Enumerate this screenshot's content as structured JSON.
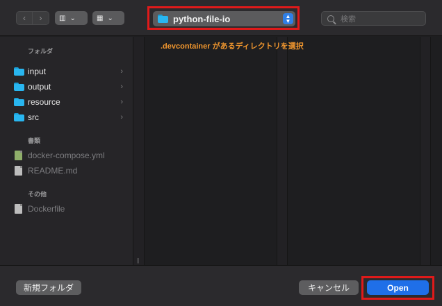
{
  "toolbar": {
    "back_glyph": "‹",
    "forward_glyph": "›",
    "column_view_glyph": "▥",
    "icon_view_glyph": "▦",
    "dropdown_glyph": "⌄",
    "path_label": "python-file-io",
    "stepper_up": "▲",
    "stepper_down": "▼",
    "search_placeholder": "検索"
  },
  "sidebar": {
    "folders_title": "フォルダ",
    "folders": [
      {
        "label": "input"
      },
      {
        "label": "output"
      },
      {
        "label": "resource"
      },
      {
        "label": "src"
      }
    ],
    "documents_title": "書類",
    "documents": [
      {
        "label": "docker-compose.yml"
      },
      {
        "label": "README.md"
      }
    ],
    "other_title": "その他",
    "other": [
      {
        "label": "Dockerfile"
      }
    ],
    "chevron": "›"
  },
  "annotation": ".devcontainer があるディレクトリを選択",
  "resize_glyph": "||",
  "footer": {
    "new_folder_label": "新規フォルダ",
    "cancel_label": "キャンセル",
    "open_label": "Open"
  },
  "colors": {
    "accent": "#1f6fe8",
    "highlight_frame": "#e01a1a",
    "annotation": "#f0962e",
    "folder": "#29b6f0"
  }
}
